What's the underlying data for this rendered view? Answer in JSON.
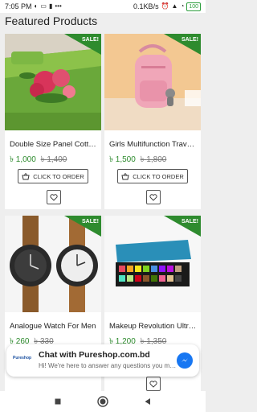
{
  "status_bar": {
    "time": "7:05 PM",
    "speed": "0.1KB/s",
    "battery": "100",
    "left_icons": [
      "data-saver-icon",
      "sim-icon",
      "message-icon",
      "sim-card-icon",
      "dots-icon"
    ],
    "right_icons": [
      "alarm-icon",
      "signal-icon",
      "wifi-icon",
      "battery-icon"
    ]
  },
  "section_title": "Featured Products",
  "sale_label": "SALE!",
  "order_label": "CLICK TO ORDER",
  "currency": "৳",
  "products": [
    {
      "title": "Double Size Panel Cotton Bed Sheet",
      "price": "1,000",
      "old_price": "1,400"
    },
    {
      "title": "Girls Multifunction Travel Backpack",
      "price": "1,500",
      "old_price": "1,800"
    },
    {
      "title": "Analogue Watch For Men",
      "price": "260",
      "old_price": "330"
    },
    {
      "title": "Makeup Revolution Ultra Eyeshadow Palette",
      "price": "1,200",
      "old_price": "1,350"
    }
  ],
  "chat": {
    "logo_text": "Pureshop",
    "title": "Chat with Pureshop.com.bd",
    "subtitle": "Hi! We're here to answer any questions you may have."
  },
  "colors": {
    "sale_green": "#2e8b2e",
    "price_green": "#2e8b2e",
    "messenger_blue": "#1877f2"
  }
}
